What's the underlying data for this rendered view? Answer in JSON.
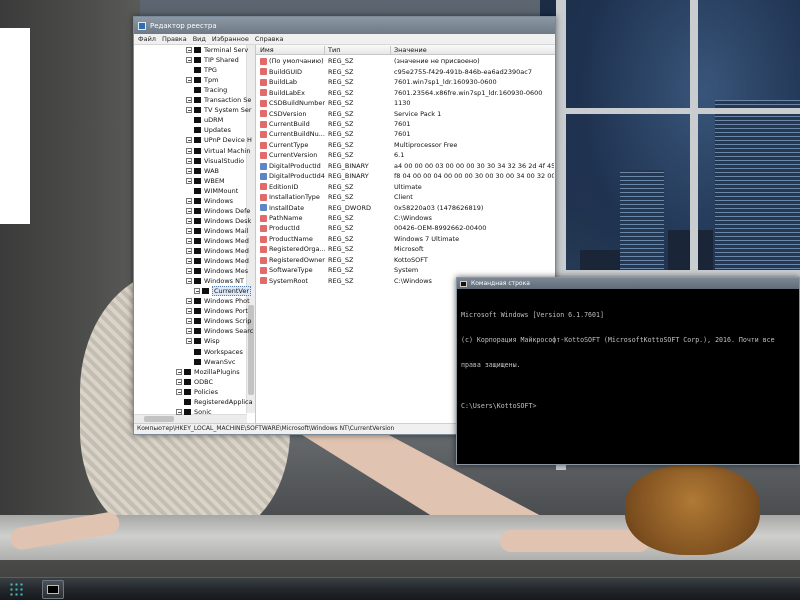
{
  "regedit": {
    "title": "Редактор реестра",
    "menu": [
      "Файл",
      "Правка",
      "Вид",
      "Избранное",
      "Справка"
    ],
    "tree": [
      {
        "label": "Terminal Serv",
        "expander": true
      },
      {
        "label": "TIP Shared",
        "expander": true
      },
      {
        "label": "TPG",
        "expander": false
      },
      {
        "label": "Tpm",
        "expander": true
      },
      {
        "label": "Tracing",
        "expander": false
      },
      {
        "label": "Transaction Se",
        "expander": true
      },
      {
        "label": "TV System Ser",
        "expander": true
      },
      {
        "label": "uDRM",
        "expander": false
      },
      {
        "label": "Updates",
        "expander": false
      },
      {
        "label": "UPnP Device H",
        "expander": true
      },
      {
        "label": "Virtual Machin",
        "expander": true
      },
      {
        "label": "VisualStudio",
        "expander": true
      },
      {
        "label": "WAB",
        "expander": true
      },
      {
        "label": "WBEM",
        "expander": true
      },
      {
        "label": "WIMMount",
        "expander": false
      },
      {
        "label": "Windows",
        "expander": true
      },
      {
        "label": "Windows Defe",
        "expander": true
      },
      {
        "label": "Windows Desk",
        "expander": true
      },
      {
        "label": "Windows Mail",
        "expander": true
      },
      {
        "label": "Windows Med",
        "expander": true
      },
      {
        "label": "Windows Med",
        "expander": true
      },
      {
        "label": "Windows Med",
        "expander": true
      },
      {
        "label": "Windows Mes",
        "expander": true
      },
      {
        "label": "Windows NT",
        "expander": true
      },
      {
        "label": "CurrentVer",
        "expander": true
      },
      {
        "label": "Windows Phot",
        "expander": true
      },
      {
        "label": "Windows Port",
        "expander": true
      },
      {
        "label": "Windows Scrip",
        "expander": true
      },
      {
        "label": "Windows Searc",
        "expander": true
      },
      {
        "label": "Wisp",
        "expander": true
      },
      {
        "label": "Workspaces",
        "expander": false
      },
      {
        "label": "WwanSvc",
        "expander": false
      },
      {
        "label": "MozillaPlugins",
        "expander": true
      },
      {
        "label": "ODBC",
        "expander": true
      },
      {
        "label": "Policies",
        "expander": true
      },
      {
        "label": "RegisteredApplica",
        "expander": false
      },
      {
        "label": "Sonic",
        "expander": true
      }
    ],
    "selected_key": "CurrentVer",
    "columns": [
      "Имя",
      "Тип",
      "Значение"
    ],
    "values": [
      {
        "name": "(По умолчанию)",
        "type": "REG_SZ",
        "data": "(значение не присвоено)",
        "icon": "string-value-icon"
      },
      {
        "name": "BuildGUID",
        "type": "REG_SZ",
        "data": "c95e2755-f429-491b-846b-ea6ad2390ac7",
        "icon": "string-value-icon"
      },
      {
        "name": "BuildLab",
        "type": "REG_SZ",
        "data": "7601.win7sp1_ldr.160930-0600",
        "icon": "string-value-icon"
      },
      {
        "name": "BuildLabEx",
        "type": "REG_SZ",
        "data": "7601.23564.x86fre.win7sp1_ldr.160930-0600",
        "icon": "string-value-icon"
      },
      {
        "name": "CSDBuildNumber",
        "type": "REG_SZ",
        "data": "1130",
        "icon": "string-value-icon"
      },
      {
        "name": "CSDVersion",
        "type": "REG_SZ",
        "data": "Service Pack 1",
        "icon": "string-value-icon"
      },
      {
        "name": "CurrentBuild",
        "type": "REG_SZ",
        "data": "7601",
        "icon": "string-value-icon"
      },
      {
        "name": "CurrentBuildNu...",
        "type": "REG_SZ",
        "data": "7601",
        "icon": "string-value-icon"
      },
      {
        "name": "CurrentType",
        "type": "REG_SZ",
        "data": "Multiprocessor Free",
        "icon": "string-value-icon"
      },
      {
        "name": "CurrentVersion",
        "type": "REG_SZ",
        "data": "6.1",
        "icon": "string-value-icon"
      },
      {
        "name": "DigitalProductId",
        "type": "REG_BINARY",
        "data": "a4 00 00 00 03 00 00 00 30 30 34 32 36 2d 4f 45 4d 2...",
        "icon": "binary-value-icon"
      },
      {
        "name": "DigitalProductId4",
        "type": "REG_BINARY",
        "data": "f8 04 00 00 04 00 00 00 30 00 30 00 34 00 32 00 36 00...",
        "icon": "binary-value-icon"
      },
      {
        "name": "EditionID",
        "type": "REG_SZ",
        "data": "Ultimate",
        "icon": "string-value-icon"
      },
      {
        "name": "InstallationType",
        "type": "REG_SZ",
        "data": "Client",
        "icon": "string-value-icon"
      },
      {
        "name": "InstallDate",
        "type": "REG_DWORD",
        "data": "0x58220a03 (1478626819)",
        "icon": "binary-value-icon"
      },
      {
        "name": "PathName",
        "type": "REG_SZ",
        "data": "C:\\Windows",
        "icon": "string-value-icon"
      },
      {
        "name": "ProductId",
        "type": "REG_SZ",
        "data": "00426-OEM-8992662-00400",
        "icon": "string-value-icon"
      },
      {
        "name": "ProductName",
        "type": "REG_SZ",
        "data": "Windows 7 Ultimate",
        "icon": "string-value-icon"
      },
      {
        "name": "RegisteredOrga...",
        "type": "REG_SZ",
        "data": "Microsoft",
        "icon": "string-value-icon"
      },
      {
        "name": "RegisteredOwner",
        "type": "REG_SZ",
        "data": "KottoSOFT",
        "icon": "string-value-icon"
      },
      {
        "name": "SoftwareType",
        "type": "REG_SZ",
        "data": "System",
        "icon": "string-value-icon"
      },
      {
        "name": "SystemRoot",
        "type": "REG_SZ",
        "data": "C:\\Windows",
        "icon": "string-value-icon"
      }
    ],
    "status_path": "Компьютер\\HKEY_LOCAL_MACHINE\\SOFTWARE\\Microsoft\\Windows NT\\CurrentVersion"
  },
  "cmd": {
    "title": "Командная строка",
    "lines": [
      "Microsoft Windows [Version 6.1.7601]",
      "(c) Корпорация Майкрософт-KottoSOFT (MicrosoftKottoSOFT Corp.), 2016. Почти все",
      "права защищены.",
      "",
      "C:\\Users\\KottoSOFT>"
    ]
  },
  "taskbar": {
    "start_icon": "windows-start-icon",
    "apps": [
      {
        "icon": "command-prompt-icon",
        "name": "cmd"
      }
    ]
  },
  "colors": {
    "titlebar": "#7a8693",
    "selection": "#dce8f7",
    "console_text": "#c0c0c0",
    "console_bg": "#000000"
  }
}
